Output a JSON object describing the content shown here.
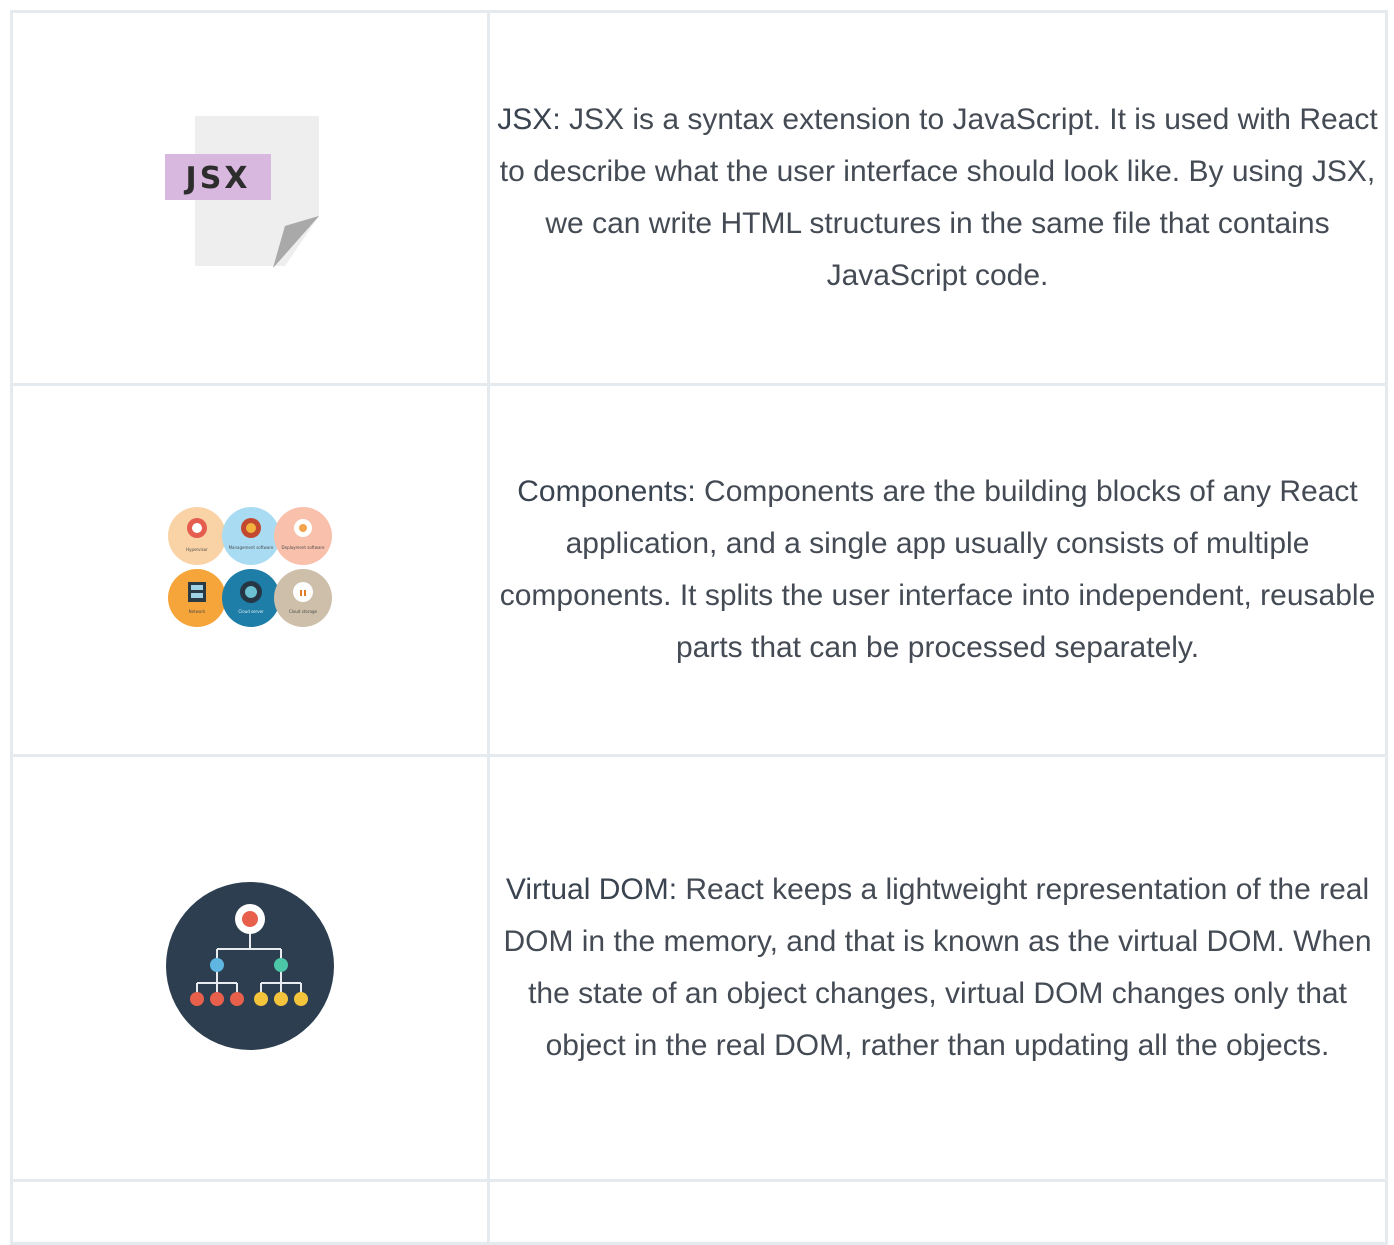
{
  "rows": [
    {
      "icon": "jsx-file-icon",
      "icon_label": "JSX",
      "term": "JSX:",
      "description": " JSX is a syntax extension to JavaScript. It is used with React to describe what the user interface should look like. By using JSX, we can write HTML structures in the same file that contains JavaScript code."
    },
    {
      "icon": "components-circles-icon",
      "icon_circles": [
        "Hypervisor",
        "Management software",
        "Deployment software",
        "Network",
        "Cloud server",
        "Cloud storage"
      ],
      "term": "Components:",
      "description": " Components are the building blocks of any React application, and a single app usually consists of multiple components. It splits the user interface into independent, reusable parts that can be processed separately."
    },
    {
      "icon": "hierarchy-tree-icon",
      "term": "Virtual DOM:",
      "description": " React keeps a lightweight representation of the real DOM in the memory, and that is known as the virtual DOM. When the state of an object changes, virtual DOM changes only that object in the real DOM, rather than updating all the objects."
    }
  ]
}
